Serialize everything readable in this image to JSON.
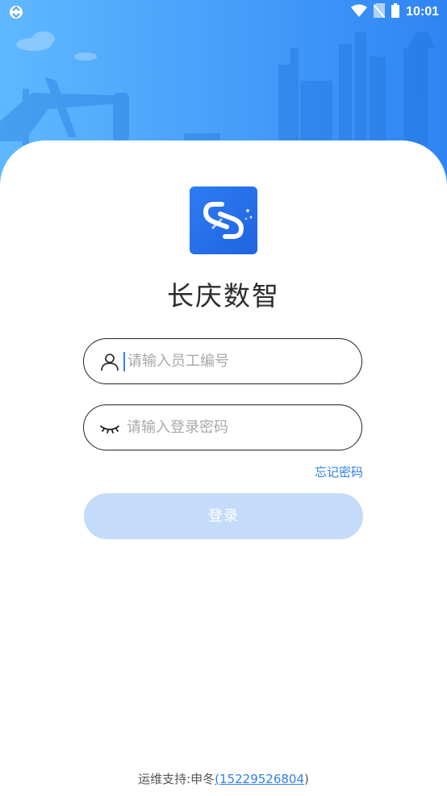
{
  "status_bar": {
    "time": "10:01"
  },
  "app": {
    "title": "长庆数智"
  },
  "login_form": {
    "username_placeholder": "请输入员工编号",
    "password_placeholder": "请输入登录密码",
    "forgot_label": "忘记密码",
    "submit_label": "登录"
  },
  "footer": {
    "support_label": "运维支持:申冬",
    "open_paren": "(",
    "phone": "15229526804",
    "close_paren": ")"
  },
  "colors": {
    "accent": "#2f84f3",
    "button_disabled": "#c4dcf9",
    "link": "#2f7fe8"
  }
}
